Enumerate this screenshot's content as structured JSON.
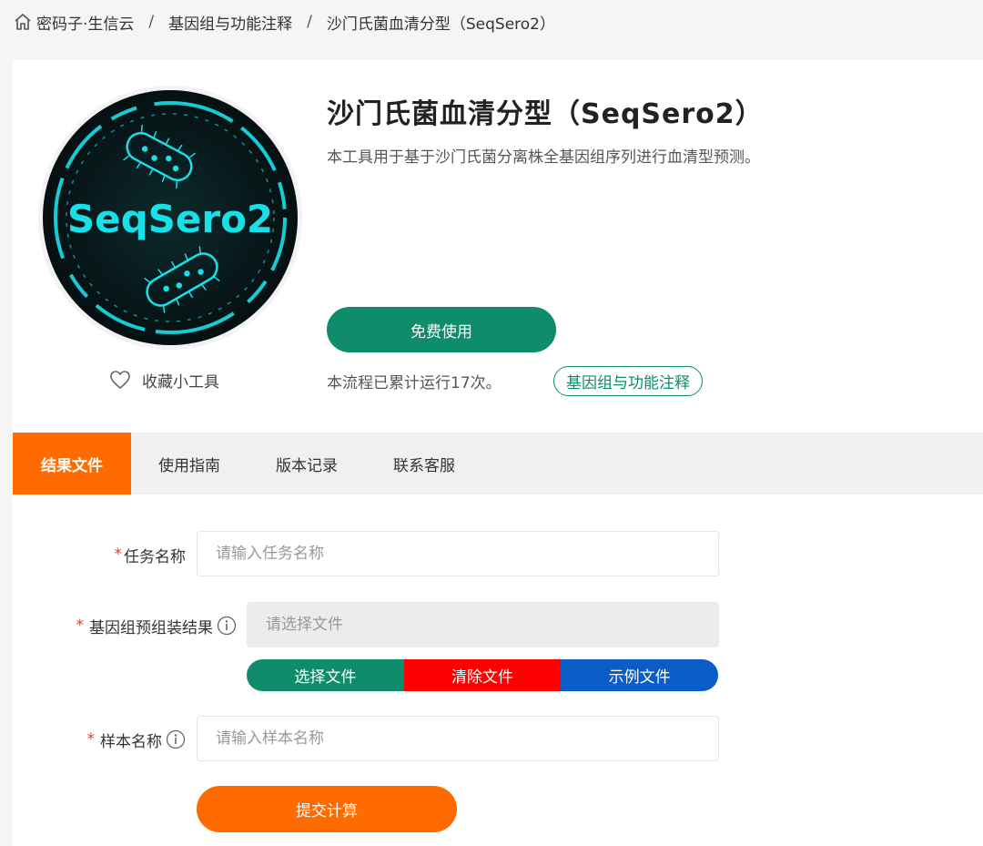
{
  "breadcrumb": {
    "home": "密码子·生信云",
    "level1": "基因组与功能注释",
    "level2": "沙门氏菌血清分型（SeqSero2）",
    "separator": "/"
  },
  "tool": {
    "title": "沙门氏菌血清分型（SeqSero2）",
    "description": "本工具用于基于沙门氏菌分离株全基因组序列进行血清型预测。",
    "logo_text": "SeqSero2",
    "free_button": "免费使用",
    "run_count": "本流程已累计运行17次。",
    "tag": "基因组与功能注释",
    "favorite": "收藏小工具"
  },
  "tabs": [
    {
      "label": "结果文件",
      "active": true
    },
    {
      "label": "使用指南",
      "active": false
    },
    {
      "label": "版本记录",
      "active": false
    },
    {
      "label": "联系客服",
      "active": false
    }
  ],
  "form": {
    "required_mark": "*",
    "task_name": {
      "label": "任务名称",
      "placeholder": "请输入任务名称"
    },
    "assembly": {
      "label": "基因组预组装结果",
      "placeholder": "请选择文件"
    },
    "sample_name": {
      "label": "样本名称",
      "placeholder": "请输入样本名称"
    },
    "file_buttons": {
      "select": "选择文件",
      "clear": "清除文件",
      "example": "示例文件"
    },
    "submit": "提交计算"
  },
  "colors": {
    "accent_orange": "#ff6b00",
    "brand_green": "#0f8c6c",
    "clear_red": "#ff0000",
    "example_blue": "#0a5cc7",
    "logo_cyan": "#18e0e8"
  },
  "icons": {
    "home": "home-icon",
    "heart": "heart-icon",
    "info": "info-icon"
  }
}
